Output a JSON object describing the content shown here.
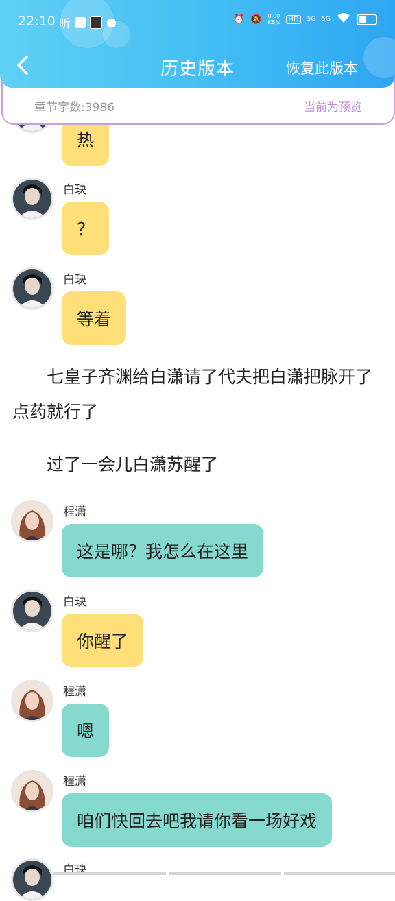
{
  "status_bar": {
    "time": "22:10",
    "app_badge": "听",
    "net_speed": "0.00\nKB/s",
    "hd_label": "HD",
    "sig1": "5G",
    "sig2": "5G"
  },
  "nav": {
    "back_icon": "chevron-left-icon",
    "title": "历史版本",
    "restore_label": "恢复此版本"
  },
  "info": {
    "word_count": "章节字数:3986",
    "preview_label": "当前为预览"
  },
  "messages": [
    {
      "type": "bubble",
      "speaker": "",
      "text": "热",
      "color": "yellow"
    },
    {
      "type": "bubble",
      "speaker": "白玦",
      "text": "？",
      "color": "yellow"
    },
    {
      "type": "bubble",
      "speaker": "白玦",
      "text": "等着",
      "color": "yellow"
    },
    {
      "type": "narration",
      "text": "七皇子齐渊给白潇请了代夫把白潇把脉开了点药就行了"
    },
    {
      "type": "narration",
      "text": "过了一会儿白潇苏醒了"
    },
    {
      "type": "bubble",
      "speaker": "程潇",
      "text": "这是哪？我怎么在这里",
      "color": "teal"
    },
    {
      "type": "bubble",
      "speaker": "白玦",
      "text": "你醒了",
      "color": "yellow"
    },
    {
      "type": "bubble",
      "speaker": "程潇",
      "text": "嗯",
      "color": "teal"
    },
    {
      "type": "bubble",
      "speaker": "程潇",
      "text": "咱们快回去吧我请你看一场好戏",
      "color": "teal"
    },
    {
      "type": "bubble",
      "speaker": "白玦",
      "text": "",
      "color": "yellow"
    }
  ],
  "colors": {
    "header_start": "#5fd0f5",
    "header_end": "#2ea6f2",
    "yellow_bubble": "#ffdf78",
    "teal_bubble": "#85d9cf",
    "preview_purple": "#c28ee0"
  }
}
